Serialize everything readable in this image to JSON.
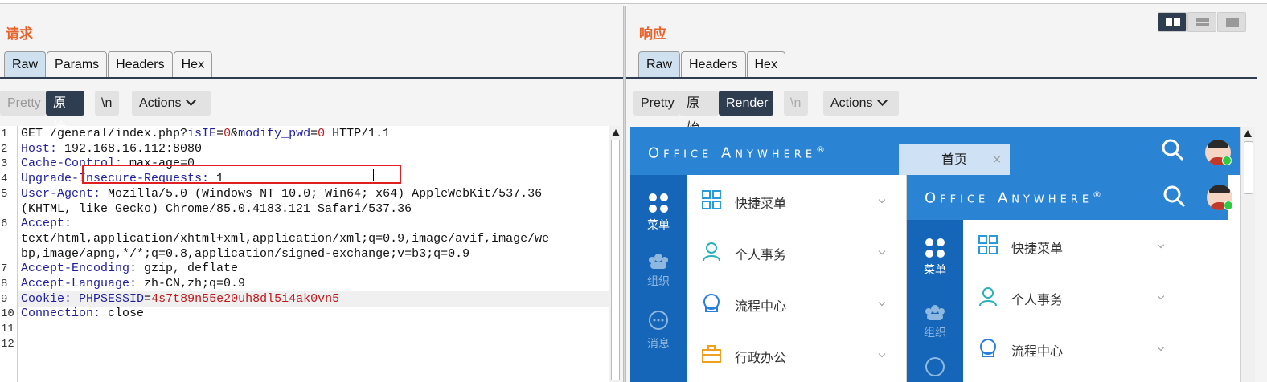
{
  "request": {
    "title": "请求",
    "tabs": [
      "Raw",
      "Params",
      "Headers",
      "Hex"
    ],
    "toolbar": {
      "pretty": "Pretty",
      "raw": "原始",
      "newline": "\\n",
      "actions": "Actions"
    },
    "lines": [
      {
        "n": "1",
        "parts": [
          [
            "t",
            "GET /general/index.php?"
          ],
          [
            "k",
            "isIE"
          ],
          [
            "t",
            "="
          ],
          [
            "v",
            "0"
          ],
          [
            "t",
            "&"
          ],
          [
            "k",
            "modify_pwd"
          ],
          [
            "t",
            "="
          ],
          [
            "v",
            "0"
          ],
          [
            "t",
            " HTTP/1.1"
          ]
        ]
      },
      {
        "n": "2",
        "parts": [
          [
            "k",
            "Host:"
          ],
          [
            "t",
            " 192.168.16.112:8080"
          ]
        ]
      },
      {
        "n": "3",
        "parts": [
          [
            "k",
            "Cache-Control:"
          ],
          [
            "t",
            " max-age=0"
          ]
        ]
      },
      {
        "n": "4",
        "parts": [
          [
            "k",
            "Upgrade-Insecure-Requests:"
          ],
          [
            "t",
            " 1"
          ]
        ]
      },
      {
        "n": "5",
        "parts": [
          [
            "k",
            "User-Agent:"
          ],
          [
            "t",
            " Mozilla/5.0 (Windows NT 10.0; Win64; x64) AppleWebKit/537.36"
          ]
        ]
      },
      {
        "n": "",
        "parts": [
          [
            "t",
            "(KHTML, like Gecko) Chrome/85.0.4183.121 Safari/537.36"
          ]
        ]
      },
      {
        "n": "6",
        "parts": [
          [
            "k",
            "Accept:"
          ]
        ]
      },
      {
        "n": "",
        "parts": [
          [
            "t",
            "text/html,application/xhtml+xml,application/xml;q=0.9,image/avif,image/we"
          ]
        ]
      },
      {
        "n": "",
        "parts": [
          [
            "t",
            "bp,image/apng,*/*;q=0.8,application/signed-exchange;v=b3;q=0.9"
          ]
        ]
      },
      {
        "n": "7",
        "parts": [
          [
            "k",
            "Accept-Encoding:"
          ],
          [
            "t",
            " gzip, deflate"
          ]
        ]
      },
      {
        "n": "8",
        "parts": [
          [
            "k",
            "Accept-Language:"
          ],
          [
            "t",
            " zh-CN,zh;q=0.9"
          ]
        ]
      },
      {
        "n": "9",
        "parts": [
          [
            "k",
            "Cookie:"
          ],
          [
            "t",
            " "
          ],
          [
            "k",
            "PHPSESSID"
          ],
          [
            "t",
            "="
          ],
          [
            "v",
            "4s7t89n55e20uh8dl5i4ak0vn5"
          ]
        ]
      },
      {
        "n": "10",
        "parts": [
          [
            "k",
            "Connection:"
          ],
          [
            "t",
            " close"
          ]
        ]
      },
      {
        "n": "11",
        "parts": []
      },
      {
        "n": "12",
        "parts": []
      }
    ]
  },
  "response": {
    "title": "响应",
    "tabs": [
      "Raw",
      "Headers",
      "Hex"
    ],
    "toolbar": {
      "pretty": "Pretty",
      "raw": "原始",
      "render": "Render",
      "newline": "\\n",
      "actions": "Actions"
    }
  },
  "render": {
    "logo": "Office Anywhere",
    "tab_home": "首页",
    "tab_close": "×",
    "side": [
      "菜单",
      "组织",
      "消息"
    ],
    "menu": [
      "快捷菜单",
      "个人事务",
      "流程中心",
      "行政办公"
    ],
    "colors": {
      "header": "#2a83d3",
      "sidebar": "#1565b8",
      "icon": "#2a9bd8",
      "accent": "#f0a020"
    }
  }
}
